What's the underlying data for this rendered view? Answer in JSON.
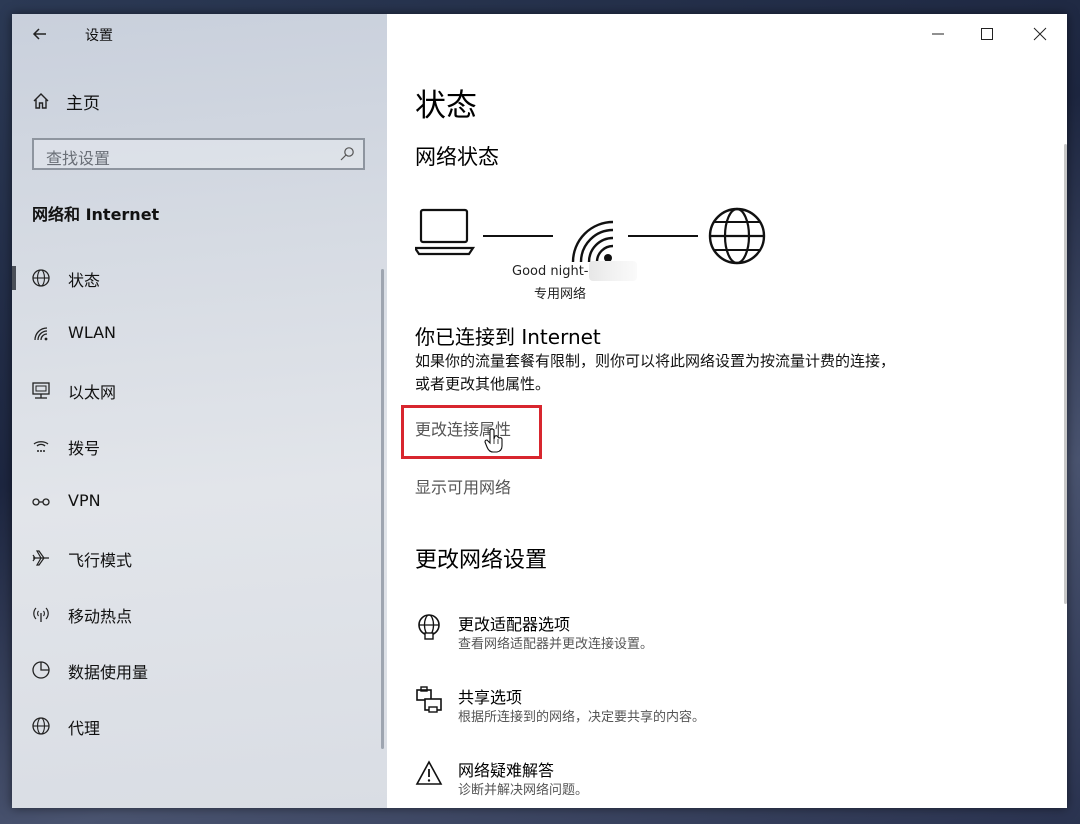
{
  "app": {
    "title": "设置",
    "back_icon": "back-arrow-icon"
  },
  "sidebar": {
    "home_label": "主页",
    "search_placeholder": "查找设置",
    "section_title": "网络和 Internet",
    "items": [
      {
        "label": "状态",
        "icon": "globe-status-icon",
        "selected": true
      },
      {
        "label": "WLAN",
        "icon": "wifi-icon",
        "selected": false
      },
      {
        "label": "以太网",
        "icon": "ethernet-icon",
        "selected": false
      },
      {
        "label": "拨号",
        "icon": "dialup-icon",
        "selected": false
      },
      {
        "label": "VPN",
        "icon": "vpn-icon",
        "selected": false
      },
      {
        "label": "飞行模式",
        "icon": "airplane-icon",
        "selected": false
      },
      {
        "label": "移动热点",
        "icon": "hotspot-icon",
        "selected": false
      },
      {
        "label": "数据使用量",
        "icon": "data-usage-icon",
        "selected": false
      },
      {
        "label": "代理",
        "icon": "proxy-globe-icon",
        "selected": false
      }
    ]
  },
  "main": {
    "page_title": "状态",
    "network_status_title": "网络状态",
    "network_name": "Good night-",
    "network_type": "专用网络",
    "connected_title": "你已连接到 Internet",
    "connected_desc": "如果你的流量套餐有限制，则你可以将此网络设置为按流量计费的连接，或者更改其他属性。",
    "change_props_link": "更改连接属性",
    "show_networks_link": "显示可用网络",
    "change_settings_title": "更改网络设置",
    "options": [
      {
        "title": "更改适配器选项",
        "desc": "查看网络适配器并更改连接设置。",
        "icon": "adapter-globe-icon"
      },
      {
        "title": "共享选项",
        "desc": "根据所连接到的网络，决定要共享的内容。",
        "icon": "sharing-printer-icon"
      },
      {
        "title": "网络疑难解答",
        "desc": "诊断并解决网络问题。",
        "icon": "warning-icon"
      }
    ]
  },
  "colors": {
    "highlight_border": "#d8262e",
    "sidebar_bg": "#d6dbe3"
  }
}
